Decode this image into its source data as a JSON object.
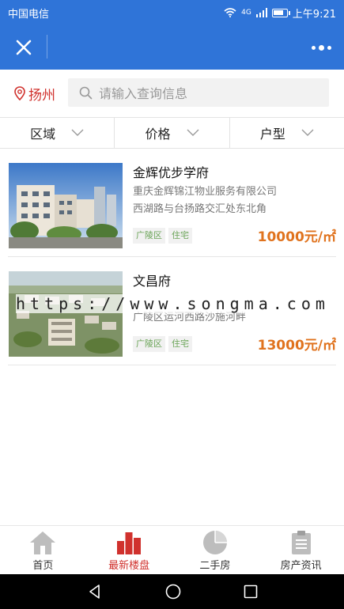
{
  "status": {
    "carrier": "中国电信",
    "time": "上午9:21",
    "signal_text": "4G",
    "battery_level": 0.8
  },
  "titlebar": {
    "close_icon": "close-icon",
    "more_icon": "more-dots-icon"
  },
  "search": {
    "city": "扬州",
    "placeholder": "请输入查询信息"
  },
  "filters": [
    {
      "label": "区域"
    },
    {
      "label": "价格"
    },
    {
      "label": "户型"
    }
  ],
  "listings": [
    {
      "name": "金辉优步学府",
      "developer": "重庆金辉锦江物业服务有限公司",
      "address": "西湖路与台扬路交汇处东北角",
      "tags": [
        "广陵区",
        "住宅"
      ],
      "price": "10000元/㎡"
    },
    {
      "name": "文昌府",
      "developer": "",
      "address": "广陵区运河西路沙施河畔",
      "tags": [
        "广陵区",
        "住宅"
      ],
      "price": "13000元/㎡"
    }
  ],
  "watermark": "https://www.songma.com",
  "tabs": [
    {
      "label": "首页",
      "icon": "home-icon"
    },
    {
      "label": "最新楼盘",
      "icon": "bar-chart-icon",
      "active": true
    },
    {
      "label": "二手房",
      "icon": "pie-chart-icon"
    },
    {
      "label": "房产资讯",
      "icon": "clipboard-icon"
    }
  ],
  "colors": {
    "primary": "#2f74d8",
    "accent_red": "#d0312d",
    "price": "#e0731e",
    "tag_text": "#6aa457"
  }
}
